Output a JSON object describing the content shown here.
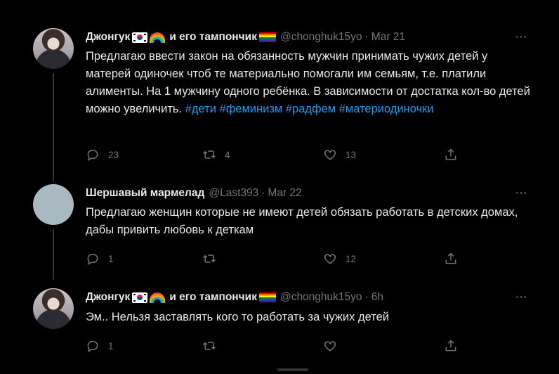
{
  "tweets": [
    {
      "name": "Джонгук",
      "suffix": "и его тампончик",
      "handle": "@chonghuk15yo",
      "date": "Mar 21",
      "text_plain": "Предлагаю ввести закон на обязанность мужчин принимать чужих детей у матерей одиночек чтоб те материально помогали им семьям, т.е. платили алименты. На 1 мужчину одного ребёнка. В зависимости от достатка кол-во детей можно увеличить.",
      "hashtags": [
        "#дети",
        "#феминизм",
        "#радфем",
        "#материодиночки"
      ],
      "replies": "23",
      "retweets": "4",
      "likes": "13"
    },
    {
      "name": "Шершавый мармелад",
      "handle": "@Last393",
      "date": "Mar 22",
      "text_plain": "Предлагаю женщин которые не имеют детей обязать работать в детских домах, дабы привить любовь к деткам",
      "replies": "1",
      "retweets": "",
      "likes": "12"
    },
    {
      "name": "Джонгук",
      "suffix": "и его тампончик",
      "handle": "@chonghuk15yo",
      "date": "6h",
      "text_plain": "Эм.. Нельзя заставлять кого то работать за чужих детей",
      "replies": "1",
      "retweets": "",
      "likes": ""
    }
  ],
  "ui": {
    "dot": "·",
    "more": "···",
    "icons": [
      "reply-icon",
      "retweet-icon",
      "like-icon",
      "share-icon"
    ]
  },
  "colors": {
    "background": "#000000",
    "text": "#e7e9ea",
    "muted": "#71767b",
    "hashtag": "#1d9bf0"
  }
}
